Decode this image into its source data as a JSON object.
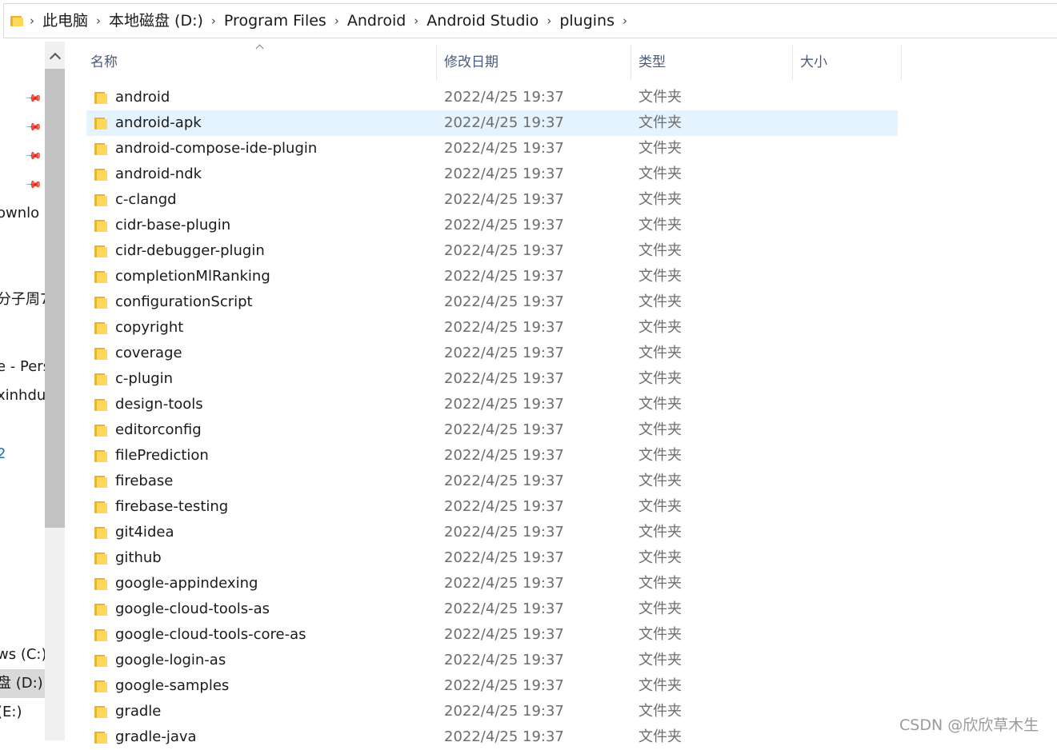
{
  "breadcrumb": [
    "此电脑",
    "本地磁盘 (D:)",
    "Program Files",
    "Android",
    "Android Studio",
    "plugins"
  ],
  "nav": {
    "items": [
      {
        "label": "ownlo",
        "top": 0
      },
      {
        "label": "分子周7",
        "top": 0
      },
      {
        "label": "e - Pers",
        "top": 0
      },
      {
        "label": "xinhdu",
        "top": 0
      },
      {
        "label": "2",
        "top": 0
      },
      {
        "label": "ws (C:)",
        "top": 0
      },
      {
        "label": "盘 (D:)",
        "top": 0
      },
      {
        "label": "(E:)",
        "top": 0
      }
    ]
  },
  "columns": {
    "name": "名称",
    "date": "修改日期",
    "type": "类型",
    "size": "大小"
  },
  "files": [
    {
      "name": "android",
      "date": "2022/4/25 19:37",
      "type": "文件夹"
    },
    {
      "name": "android-apk",
      "date": "2022/4/25 19:37",
      "type": "文件夹",
      "selected": true
    },
    {
      "name": "android-compose-ide-plugin",
      "date": "2022/4/25 19:37",
      "type": "文件夹"
    },
    {
      "name": "android-ndk",
      "date": "2022/4/25 19:37",
      "type": "文件夹"
    },
    {
      "name": "c-clangd",
      "date": "2022/4/25 19:37",
      "type": "文件夹"
    },
    {
      "name": "cidr-base-plugin",
      "date": "2022/4/25 19:37",
      "type": "文件夹"
    },
    {
      "name": "cidr-debugger-plugin",
      "date": "2022/4/25 19:37",
      "type": "文件夹"
    },
    {
      "name": "completionMlRanking",
      "date": "2022/4/25 19:37",
      "type": "文件夹"
    },
    {
      "name": "configurationScript",
      "date": "2022/4/25 19:37",
      "type": "文件夹"
    },
    {
      "name": "copyright",
      "date": "2022/4/25 19:37",
      "type": "文件夹"
    },
    {
      "name": "coverage",
      "date": "2022/4/25 19:37",
      "type": "文件夹"
    },
    {
      "name": "c-plugin",
      "date": "2022/4/25 19:37",
      "type": "文件夹"
    },
    {
      "name": "design-tools",
      "date": "2022/4/25 19:37",
      "type": "文件夹"
    },
    {
      "name": "editorconfig",
      "date": "2022/4/25 19:37",
      "type": "文件夹"
    },
    {
      "name": "filePrediction",
      "date": "2022/4/25 19:37",
      "type": "文件夹"
    },
    {
      "name": "firebase",
      "date": "2022/4/25 19:37",
      "type": "文件夹"
    },
    {
      "name": "firebase-testing",
      "date": "2022/4/25 19:37",
      "type": "文件夹"
    },
    {
      "name": "git4idea",
      "date": "2022/4/25 19:37",
      "type": "文件夹"
    },
    {
      "name": "github",
      "date": "2022/4/25 19:37",
      "type": "文件夹"
    },
    {
      "name": "google-appindexing",
      "date": "2022/4/25 19:37",
      "type": "文件夹"
    },
    {
      "name": "google-cloud-tools-as",
      "date": "2022/4/25 19:37",
      "type": "文件夹"
    },
    {
      "name": "google-cloud-tools-core-as",
      "date": "2022/4/25 19:37",
      "type": "文件夹"
    },
    {
      "name": "google-login-as",
      "date": "2022/4/25 19:37",
      "type": "文件夹"
    },
    {
      "name": "google-samples",
      "date": "2022/4/25 19:37",
      "type": "文件夹"
    },
    {
      "name": "gradle",
      "date": "2022/4/25 19:37",
      "type": "文件夹"
    },
    {
      "name": "gradle-java",
      "date": "2022/4/25 19:37",
      "type": "文件夹"
    }
  ],
  "watermark": "CSDN @欣欣草木生"
}
